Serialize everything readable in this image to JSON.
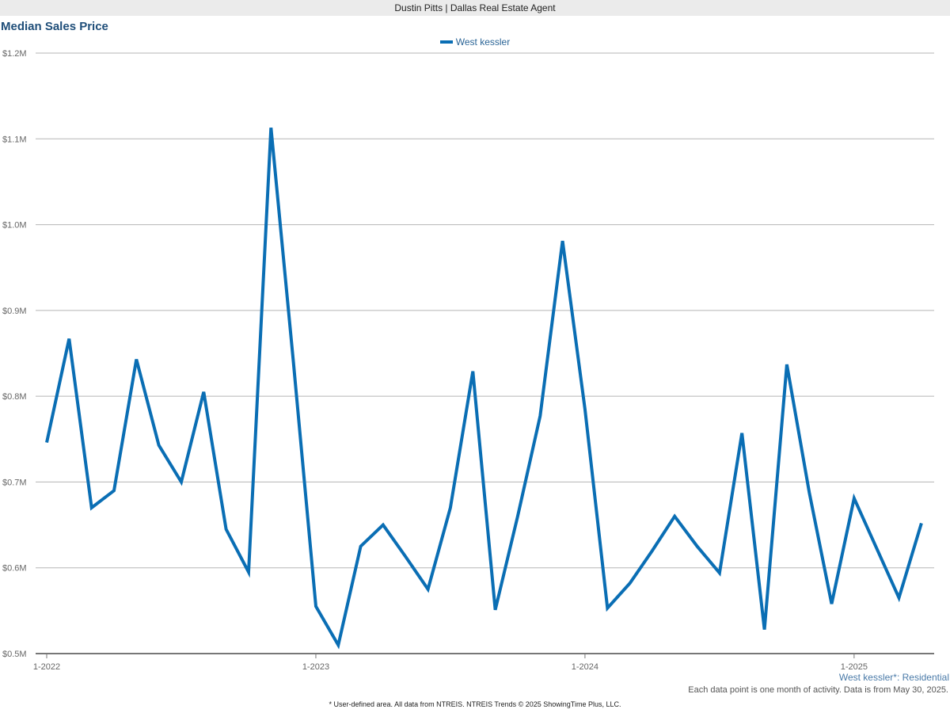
{
  "header": {
    "agent_title": "Dustin Pitts | Dallas Real Estate Agent"
  },
  "chart_data": {
    "type": "line",
    "title": "Median Sales Price",
    "xlabel": "",
    "ylabel": "",
    "x_tick_labels": [
      "1-2022",
      "1-2023",
      "1-2024",
      "1-2025"
    ],
    "y_tick_labels": [
      "$0.5M",
      "$0.6M",
      "$0.7M",
      "$0.8M",
      "$0.9M",
      "$1.0M",
      "$1.1M",
      "$1.2M"
    ],
    "ylim": [
      500000,
      1200000
    ],
    "x_start": "2022-01",
    "x": [
      "2022-01",
      "2022-02",
      "2022-03",
      "2022-04",
      "2022-05",
      "2022-06",
      "2022-07",
      "2022-08",
      "2022-09",
      "2022-10",
      "2022-11",
      "2022-12",
      "2023-01",
      "2023-02",
      "2023-03",
      "2023-04",
      "2023-05",
      "2023-06",
      "2023-07",
      "2023-08",
      "2023-09",
      "2023-10",
      "2023-11",
      "2023-12",
      "2024-01",
      "2024-02",
      "2024-03",
      "2024-04",
      "2024-05",
      "2024-06",
      "2024-07",
      "2024-08",
      "2024-09",
      "2024-10",
      "2024-11",
      "2024-12",
      "2025-01",
      "2025-02",
      "2025-03",
      "2025-04"
    ],
    "grid": true,
    "legend_position": "top-center",
    "series": [
      {
        "name": "West kessler",
        "color": "#0a6eb4",
        "values": [
          746000,
          867000,
          670000,
          690000,
          843000,
          743000,
          700000,
          805000,
          645000,
          595000,
          1113000,
          840000,
          555000,
          510000,
          625000,
          650000,
          613000,
          575000,
          670000,
          829000,
          551000,
          660000,
          777000,
          981000,
          785000,
          553000,
          582000,
          620000,
          660000,
          625000,
          594000,
          757000,
          528000,
          837000,
          688000,
          558000,
          681000,
          623000,
          565000,
          652000
        ]
      }
    ]
  },
  "footer": {
    "area_label": "West kessler*: Residential",
    "note": "Each data point is one month of activity. Data is from May 30, 2025.",
    "source": "* User-defined area. All data from NTREIS. NTREIS Trends © 2025 ShowingTime Plus, LLC."
  }
}
